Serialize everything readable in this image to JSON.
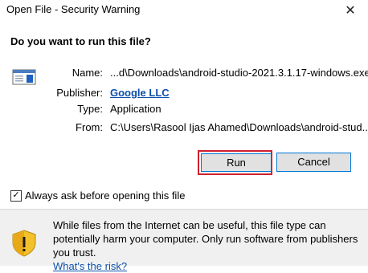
{
  "window": {
    "title": "Open File - Security Warning",
    "close_glyph": "✕"
  },
  "dialog": {
    "question": "Do you want to run this file?",
    "icon": "application-file-icon",
    "fields": {
      "name_label": "Name:",
      "name_value": "...d\\Downloads\\android-studio-2021.3.1.17-windows.exe",
      "publisher_label": "Publisher:",
      "publisher_value": "Google LLC",
      "type_label": "Type:",
      "type_value": "Application",
      "from_label": "From:",
      "from_value": "C:\\Users\\Rasool Ijas Ahamed\\Downloads\\android-stud..."
    },
    "buttons": {
      "run": "Run",
      "cancel": "Cancel"
    },
    "checkbox": {
      "label": "Always ask before opening this file",
      "checked": true,
      "check_glyph": "✓"
    }
  },
  "warning": {
    "icon": "shield-warning-icon",
    "text": "While files from the Internet can be useful, this file type can potentially harm your computer. Only run software from publishers you trust.",
    "risk_link": "What's the risk?"
  },
  "colors": {
    "link": "#0b4eaa",
    "highlight": "#d0202f",
    "button_focus": "#0078d7"
  }
}
